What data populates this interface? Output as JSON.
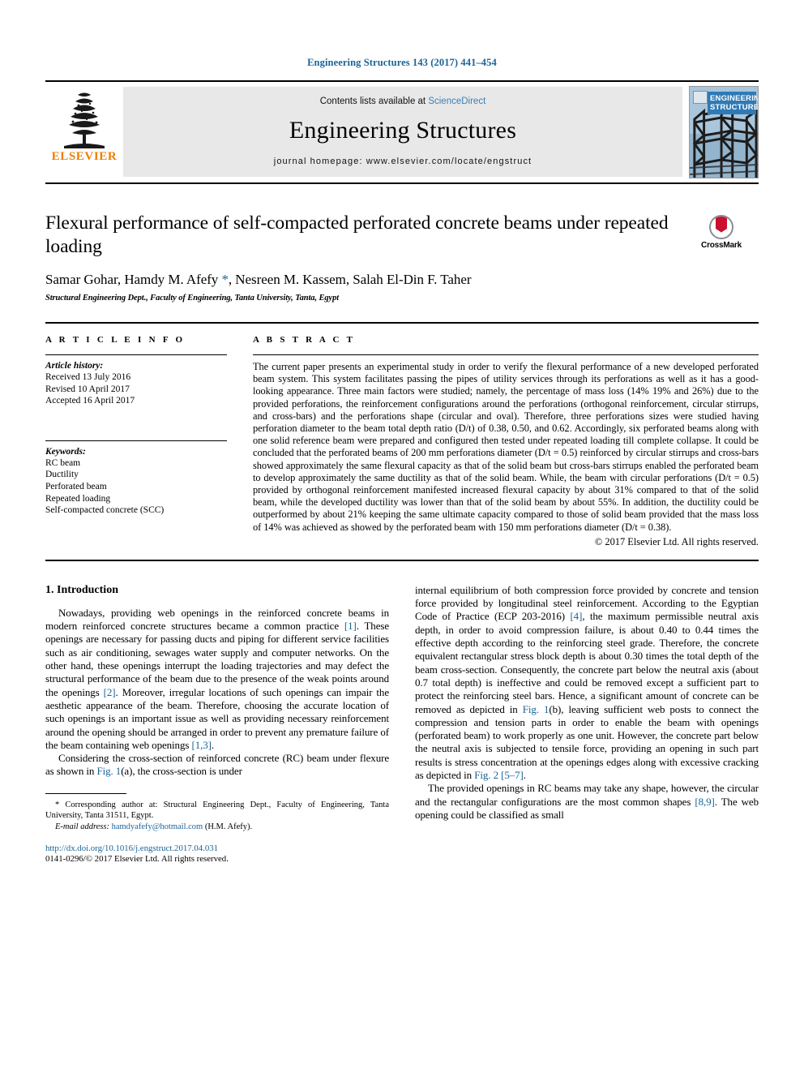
{
  "running_head": "Engineering Structures 143 (2017) 441–454",
  "masthead": {
    "publisher_name": "ELSEVIER",
    "contents_prefix": "Contents lists available at ",
    "contents_link": "ScienceDirect",
    "journal_name": "Engineering Structures",
    "homepage_line": "journal homepage: www.elsevier.com/locate/engstruct",
    "cover_title_line1": "ENGINEERING",
    "cover_title_line2": "STRUCTURES"
  },
  "title_block": {
    "title": "Flexural performance of self-compacted perforated concrete beams under repeated loading",
    "authors": "Samar Gohar, Hamdy M. Afefy ",
    "corresponding_marker": "*",
    "authors_rest": ", Nesreen M. Kassem, Salah El-Din F. Taher",
    "affiliation": "Structural Engineering Dept., Faculty of Engineering, Tanta University, Tanta, Egypt",
    "crossmark_label": "CrossMark"
  },
  "article_info": {
    "heading": "A R T I C L E  I N F O",
    "history_label": "Article history:",
    "history": [
      "Received 13 July 2016",
      "Revised 10 April 2017",
      "Accepted 16 April 2017"
    ],
    "keywords_label": "Keywords:",
    "keywords": [
      "RC beam",
      "Ductility",
      "Perforated beam",
      "Repeated loading",
      "Self-compacted concrete (SCC)"
    ]
  },
  "abstract": {
    "heading": "A B S T R A C T",
    "text": "The current paper presents an experimental study in order to verify the flexural performance of a new developed perforated beam system. This system facilitates passing the pipes of utility services through its perforations as well as it has a good-looking appearance. Three main factors were studied; namely, the percentage of mass loss (14% 19% and 26%) due to the provided perforations, the reinforcement configurations around the perforations (orthogonal reinforcement, circular stirrups, and cross-bars) and the perforations shape (circular and oval). Therefore, three perforations sizes were studied having perforation diameter to the beam total depth ratio (D/t) of 0.38, 0.50, and 0.62. Accordingly, six perforated beams along with one solid reference beam were prepared and configured then tested under repeated loading till complete collapse. It could be concluded that the perforated beams of 200 mm perforations diameter (D/t = 0.5) reinforced by circular stirrups and cross-bars showed approximately the same flexural capacity as that of the solid beam but cross-bars stirrups enabled the perforated beam to develop approximately the same ductility as that of the solid beam. While, the beam with circular perforations (D/t = 0.5) provided by orthogonal reinforcement manifested increased flexural capacity by about 31% compared to that of the solid beam, while the developed ductility was lower than that of the solid beam by about 55%. In addition, the ductility could be outperformed by about 21% keeping the same ultimate capacity compared to those of solid beam provided that the mass loss of 14% was achieved as showed by the perforated beam with 150 mm perforations diameter (D/t = 0.38).",
    "copyright": "© 2017 Elsevier Ltd. All rights reserved."
  },
  "introduction": {
    "section_number_title": "1. Introduction",
    "left_paragraph_1_a": "Nowadays, providing web openings in the reinforced concrete beams in modern reinforced concrete structures became a common practice ",
    "left_ref_1": "[1]",
    "left_paragraph_1_b": ". These openings are necessary for passing ducts and piping for different service facilities such as air conditioning, sewages water supply and computer networks. On the other hand, these openings interrupt the loading trajectories and may defect the structural performance of the beam due to the presence of the weak points around the openings ",
    "left_ref_2": "[2]",
    "left_paragraph_1_c": ". Moreover, irregular locations of such openings can impair the aesthetic appearance of the beam. Therefore, choosing the accurate location of such openings is an important issue as well as providing necessary reinforcement around the opening should be arranged in order to prevent any premature failure of the beam containing web openings ",
    "left_ref_3": "[1,3]",
    "left_paragraph_1_d": ".",
    "left_paragraph_2_a": "Considering the cross-section of reinforced concrete (RC) beam under flexure as shown in ",
    "left_fig_1a": "Fig. 1",
    "left_paragraph_2_b": "(a), the cross-section is under",
    "right_paragraph_1_a": "internal equilibrium of both compression force provided by concrete and tension force provided by longitudinal steel reinforcement. According to the Egyptian Code of Practice (ECP 203-2016) ",
    "right_ref_4": "[4]",
    "right_paragraph_1_b": ", the maximum permissible neutral axis depth, in order to avoid compression failure, is about 0.40 to 0.44 times the effective depth according to the reinforcing steel grade. Therefore, the concrete equivalent rectangular stress block depth is about 0.30 times the total depth of the beam cross-section. Consequently, the concrete part below the neutral axis (about 0.7 total depth) is ineffective and could be removed except a sufficient part to protect the reinforcing steel bars. Hence, a significant amount of concrete can be removed as depicted in ",
    "right_fig_1b": "Fig. 1",
    "right_paragraph_1_c": "(b), leaving sufficient web posts to connect the compression and tension parts in order to enable the beam with openings (perforated beam) to work properly as one unit. However, the concrete part below the neutral axis is subjected to tensile force, providing an opening in such part results is stress concentration at the openings edges along with excessive cracking as depicted in ",
    "right_fig_2": "Fig. 2 [5–7]",
    "right_paragraph_1_d": ".",
    "right_paragraph_2_a": "The provided openings in RC beams may take any shape, however, the circular and the rectangular configurations are the most common shapes ",
    "right_ref_89": "[8,9]",
    "right_paragraph_2_b": ". The web opening could be classified as small"
  },
  "footnote": {
    "corresponding_marker": "*",
    "corresponding_text": " Corresponding author at: Structural Engineering Dept., Faculty of Engineering, Tanta University, Tanta 31511, Egypt.",
    "email_label": "E-mail address:",
    "email": "hamdyafefy@hotmail.com",
    "email_owner": " (H.M. Afefy)."
  },
  "doi_block": {
    "doi_url": "http://dx.doi.org/10.1016/j.engstruct.2017.04.031",
    "issn_line": "0141-0296/© 2017 Elsevier Ltd. All rights reserved."
  },
  "colors": {
    "link_blue": "#1a6496",
    "elsevier_orange": "#ef7d00",
    "crossmark_red": "#c8102e",
    "cover_blue": "#2f7ab5"
  }
}
